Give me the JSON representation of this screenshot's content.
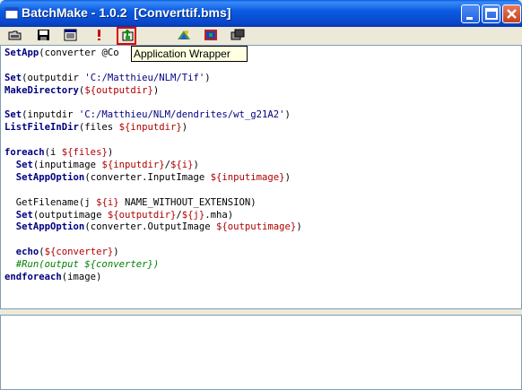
{
  "window": {
    "title": "BatchMake - 1.0.2  [Converttif.bms]"
  },
  "toolbar": {
    "buttons": [
      {
        "icon": "open-folder-icon"
      },
      {
        "icon": "save-disk-icon"
      },
      {
        "icon": "script-wizard-icon"
      },
      {
        "icon": "exclamation-icon"
      },
      {
        "icon": "application-wrapper-icon"
      },
      {
        "icon": "condor-icon"
      },
      {
        "icon": "grid-icon"
      },
      {
        "icon": "window-icon"
      }
    ],
    "tooltip": "Application Wrapper",
    "highlight_color": "#e00000"
  },
  "editor": {
    "colors": {
      "keyword": "#000080",
      "variable": "#b00000",
      "comment": "#008000",
      "string": "#000080"
    },
    "lines": [
      [
        [
          "kw",
          "SetApp"
        ],
        [
          "t",
          "(converter @Co"
        ]
      ],
      [],
      [
        [
          "kw",
          "Set"
        ],
        [
          "t",
          "(outputdir "
        ],
        [
          "str",
          "'C:/Matthieu/NLM/Tif'"
        ],
        [
          "t",
          ")"
        ]
      ],
      [
        [
          "kw",
          "MakeDirectory"
        ],
        [
          "t",
          "("
        ],
        [
          "var",
          "${outputdir}"
        ],
        [
          "t",
          ")"
        ]
      ],
      [],
      [
        [
          "kw",
          "Set"
        ],
        [
          "t",
          "(inputdir "
        ],
        [
          "str",
          "'C:/Matthieu/NLM/dendrites/wt_g21A2'"
        ],
        [
          "t",
          ")"
        ]
      ],
      [
        [
          "kw",
          "ListFileInDir"
        ],
        [
          "t",
          "(files "
        ],
        [
          "var",
          "${inputdir}"
        ],
        [
          "t",
          ")"
        ]
      ],
      [],
      [
        [
          "kw",
          "foreach"
        ],
        [
          "t",
          "(i "
        ],
        [
          "var",
          "${files}"
        ],
        [
          "t",
          ")"
        ]
      ],
      [
        [
          "t",
          "  "
        ],
        [
          "kw",
          "Set"
        ],
        [
          "t",
          "(inputimage "
        ],
        [
          "var",
          "${inputdir}"
        ],
        [
          "t",
          "/"
        ],
        [
          "var",
          "${i}"
        ],
        [
          "t",
          ")"
        ]
      ],
      [
        [
          "t",
          "  "
        ],
        [
          "kw",
          "SetAppOption"
        ],
        [
          "t",
          "(converter.InputImage "
        ],
        [
          "var",
          "${inputimage}"
        ],
        [
          "t",
          ")"
        ]
      ],
      [],
      [
        [
          "t",
          "  GetFilename(j "
        ],
        [
          "var",
          "${i}"
        ],
        [
          "t",
          " NAME_WITHOUT_EXTENSION)"
        ]
      ],
      [
        [
          "t",
          "  "
        ],
        [
          "kw",
          "Set"
        ],
        [
          "t",
          "(outputimage "
        ],
        [
          "var",
          "${outputdir}"
        ],
        [
          "t",
          "/"
        ],
        [
          "var",
          "${j}"
        ],
        [
          "t",
          ".mha)"
        ]
      ],
      [
        [
          "t",
          "  "
        ],
        [
          "kw",
          "SetAppOption"
        ],
        [
          "t",
          "(converter.OutputImage "
        ],
        [
          "var",
          "${outputimage}"
        ],
        [
          "t",
          ")"
        ]
      ],
      [],
      [
        [
          "t",
          "  "
        ],
        [
          "kw",
          "echo"
        ],
        [
          "t",
          "("
        ],
        [
          "var",
          "${converter}"
        ],
        [
          "t",
          ")"
        ]
      ],
      [
        [
          "t",
          "  "
        ],
        [
          "cm",
          "#Run(output ${converter})"
        ]
      ],
      [
        [
          "kw",
          "endforeach"
        ],
        [
          "t",
          "(image)"
        ]
      ]
    ]
  },
  "output": {
    "text": ""
  }
}
